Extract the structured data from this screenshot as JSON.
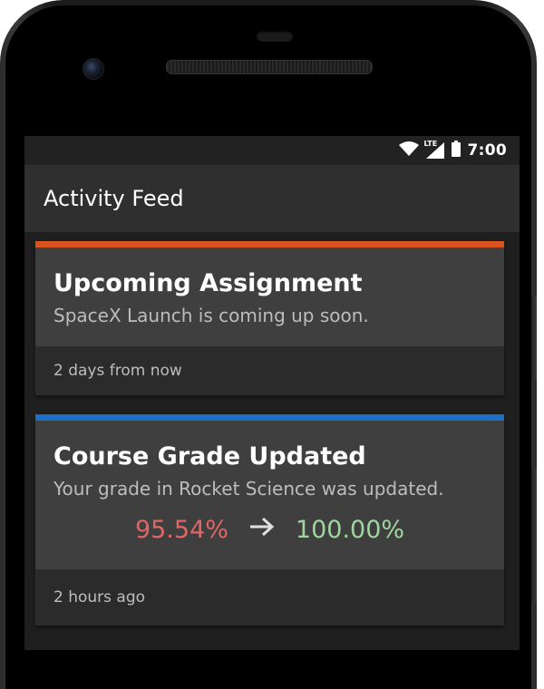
{
  "status_bar": {
    "time": "7:00",
    "network_label": "LTE",
    "icons": [
      "wifi-icon",
      "signal-icon",
      "battery-icon"
    ]
  },
  "app_bar": {
    "title": "Activity Feed"
  },
  "cards": [
    {
      "stripe_color": "#d9531e",
      "title": "Upcoming Assignment",
      "message": "SpaceX Launch is coming up soon.",
      "footer": "2 days from now"
    },
    {
      "stripe_color": "#1b6fc4",
      "title": "Course Grade Updated",
      "message": "Your grade in Rocket Science was updated.",
      "old_grade": "95.54%",
      "new_grade": "100.00%",
      "old_grade_color": "#e06666",
      "new_grade_color": "#9fd69f",
      "footer": "2 hours ago"
    }
  ]
}
